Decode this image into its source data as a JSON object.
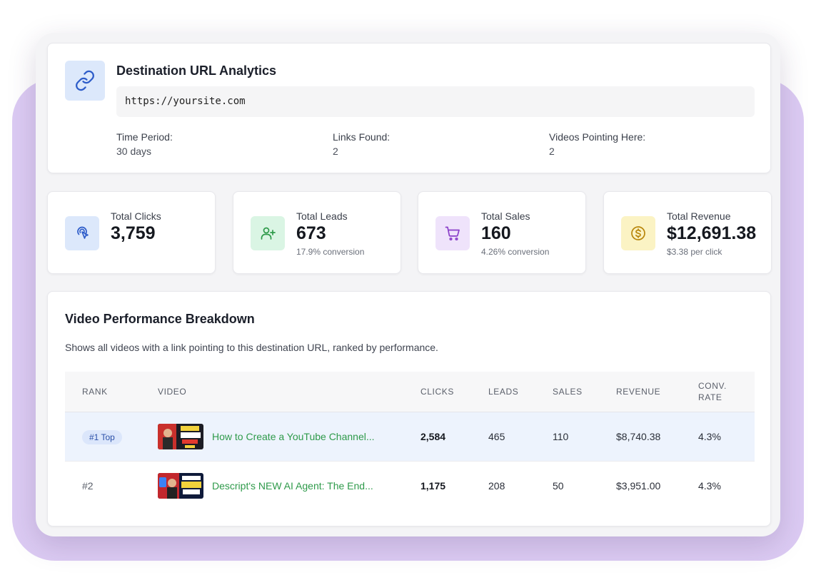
{
  "header": {
    "title": "Destination URL Analytics",
    "url": "https://yoursite.com",
    "meta": [
      {
        "label": "Time Period:",
        "value": "30 days"
      },
      {
        "label": "Links Found:",
        "value": "2"
      },
      {
        "label": "Videos Pointing Here:",
        "value": "2"
      }
    ]
  },
  "stats": [
    {
      "label": "Total Clicks",
      "value": "3,759",
      "sub": "",
      "icon": "pointer-click-icon",
      "color": "#dce8fb"
    },
    {
      "label": "Total Leads",
      "value": "673",
      "sub": "17.9% conversion",
      "icon": "user-plus-icon",
      "color": "#daf5e4"
    },
    {
      "label": "Total Sales",
      "value": "160",
      "sub": "4.26% conversion",
      "icon": "cart-icon",
      "color": "#efe3fb"
    },
    {
      "label": "Total Revenue",
      "value": "$12,691.38",
      "sub": "$3.38 per click",
      "icon": "dollar-icon",
      "color": "#fbf3c4"
    }
  ],
  "table": {
    "title": "Video Performance Breakdown",
    "description": "Shows all videos with a link pointing to this destination URL, ranked by performance.",
    "columns": [
      "RANK",
      "VIDEO",
      "CLICKS",
      "LEADS",
      "SALES",
      "REVENUE",
      "CONV.",
      "RATE"
    ],
    "rows": [
      {
        "rank": "#1 Top",
        "title": "How to Create a YouTube Channel...",
        "clicks": "2,584",
        "leads": "465",
        "sales": "110",
        "revenue": "$8,740.38",
        "rate": "4.3%"
      },
      {
        "rank": "#2",
        "title": "Descript's NEW AI Agent: The End...",
        "clicks": "1,175",
        "leads": "208",
        "sales": "50",
        "revenue": "$3,951.00",
        "rate": "4.3%"
      }
    ]
  }
}
